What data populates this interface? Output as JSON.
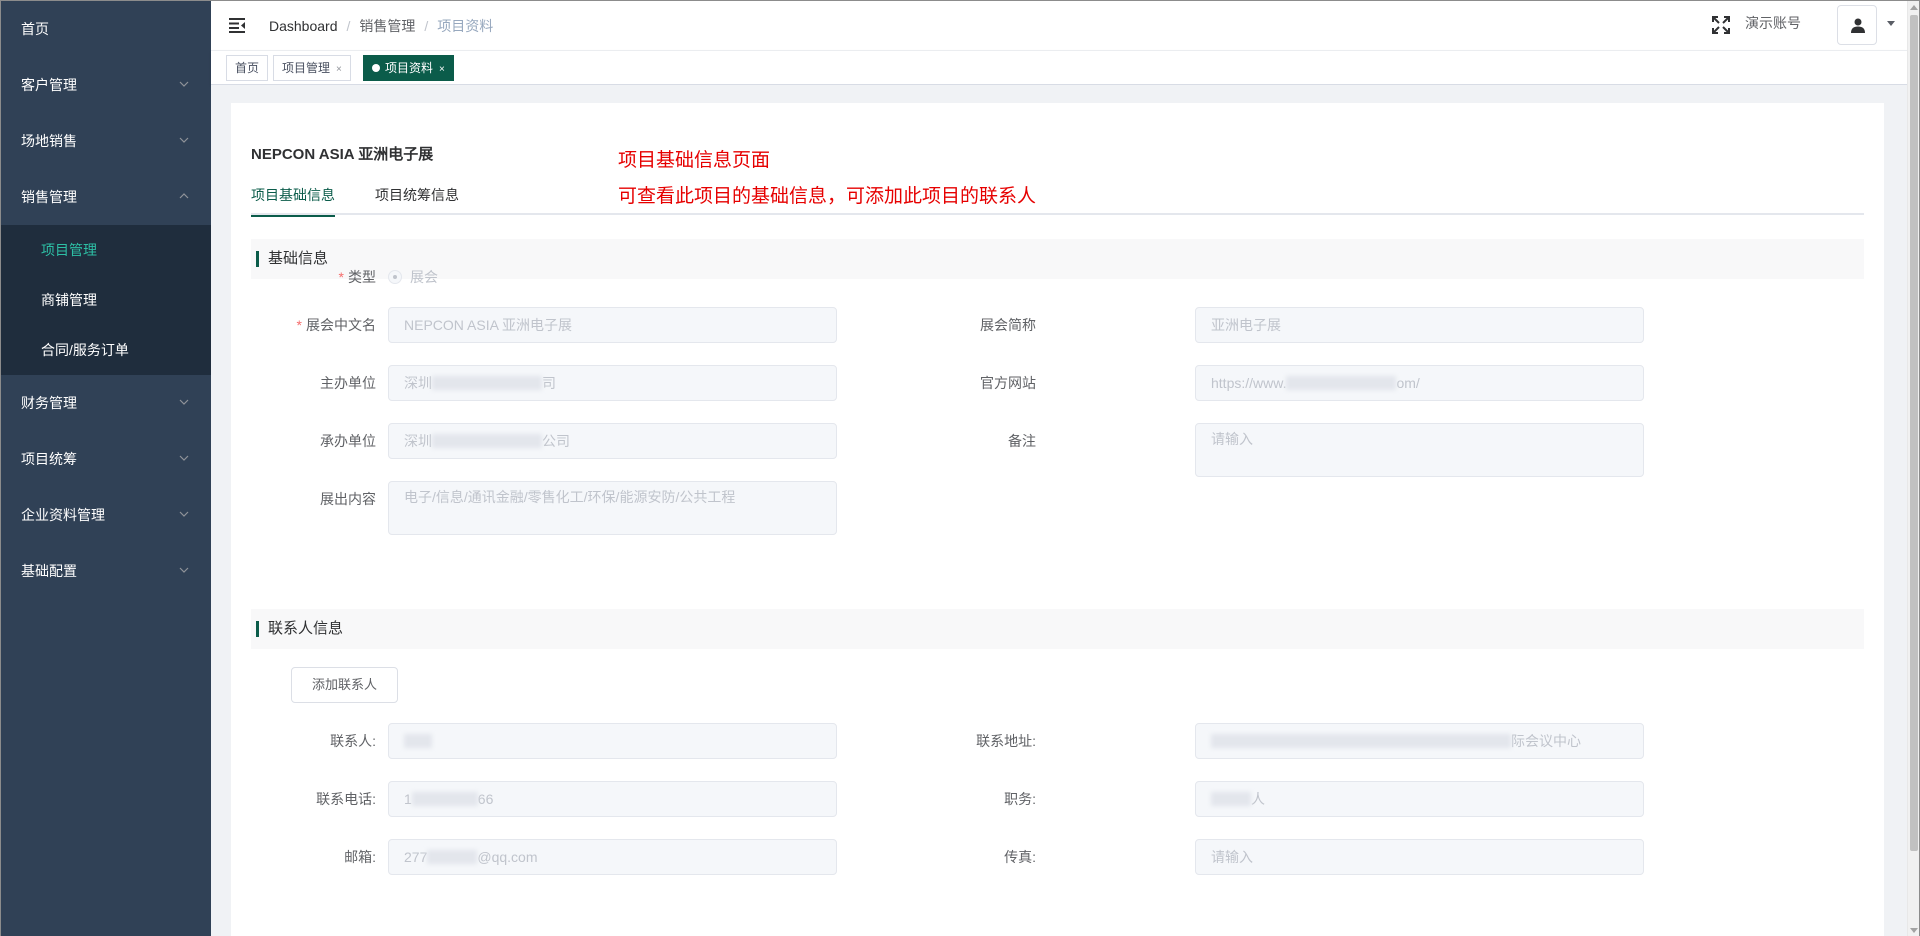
{
  "sidebar": {
    "items": [
      {
        "label": "首页"
      },
      {
        "label": "客户管理"
      },
      {
        "label": "场地销售"
      },
      {
        "label": "销售管理"
      },
      {
        "label": "财务管理"
      },
      {
        "label": "项目统筹"
      },
      {
        "label": "企业资料管理"
      },
      {
        "label": "基础配置"
      }
    ],
    "sales_submenu": [
      {
        "label": "项目管理"
      },
      {
        "label": "商铺管理"
      },
      {
        "label": "合同/服务订单"
      }
    ]
  },
  "navbar": {
    "breadcrumb": [
      "Dashboard",
      "销售管理",
      "项目资料"
    ],
    "account_name": "演示账号"
  },
  "tags": [
    {
      "label": "首页"
    },
    {
      "label": "项目管理",
      "close": "×"
    },
    {
      "label": "项目资料",
      "close": "×"
    }
  ],
  "page": {
    "project_title": "NEPCON ASIA 亚洲电子展",
    "annotation_line1": "项目基础信息页面",
    "annotation_line2": "可查看此项目的基础信息，可添加此项目的联系人",
    "tabs": [
      "项目基础信息",
      "项目统筹信息"
    ],
    "sections": {
      "basic": "基础信息",
      "contact": "联系人信息"
    },
    "basic_form": {
      "type_label": "类型",
      "type_value": "展会",
      "cn_name_label": "展会中文名",
      "cn_name_value": "NEPCON ASIA 亚洲电子展",
      "short_name_label": "展会简称",
      "short_name_value": "亚洲电子展",
      "organizer_label": "主办单位",
      "organizer_prefix": "深圳",
      "organizer_suffix": "司",
      "website_label": "官方网站",
      "website_prefix": "https://www.",
      "website_suffix": "om/",
      "undertaker_label": "承办单位",
      "undertaker_prefix": "深圳",
      "undertaker_suffix": "公司",
      "remark_label": "备注",
      "remark_placeholder": "请输入",
      "content_label": "展出内容",
      "content_value": "电子/信息/通讯金融/零售化工/环保/能源安防/公共工程"
    },
    "contact_form": {
      "add_button": "添加联系人",
      "contact_label": "联系人:",
      "address_label": "联系地址:",
      "address_suffix": "际会议中心",
      "phone_label": "联系电话:",
      "phone_prefix": "1",
      "phone_suffix": "66",
      "position_label": "职务:",
      "position_suffix": "人",
      "email_label": "邮箱:",
      "email_prefix": "277",
      "email_suffix": "@qq.com",
      "fax_label": "传真:",
      "fax_placeholder": "请输入"
    }
  },
  "colors": {
    "sidebar_bg": "#304156",
    "submenu_bg": "#1f2d3d",
    "accent": "#0b5c4a",
    "active_menu_text": "#2dbfa5",
    "annotation": "#e60000",
    "required": "#f56c6c"
  },
  "icons": {
    "hamburger": "hamburger-icon",
    "fullscreen": "fullscreen-icon",
    "avatar": "user-icon",
    "dropdown": "caret-down-icon",
    "submenu_arrow": "chevron-down-icon"
  }
}
